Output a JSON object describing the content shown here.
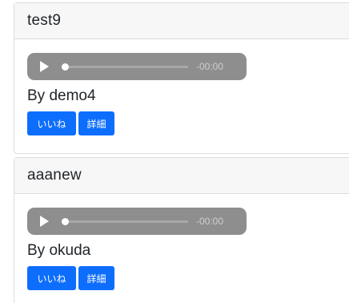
{
  "posts": [
    {
      "title": "test9",
      "audio": {
        "time": "-00:00",
        "progress": 0
      },
      "byline": "By demo4",
      "like_label": "いいね",
      "detail_label": "詳細"
    },
    {
      "title": "aaanew",
      "audio": {
        "time": "-00:00",
        "progress": 0
      },
      "byline": "By okuda",
      "like_label": "いいね",
      "detail_label": "詳細"
    }
  ],
  "colors": {
    "primary": "#0d6efd",
    "audio_bg": "#8e8e8e",
    "header_bg": "#f7f7f7",
    "border": "#dcdcdc"
  },
  "icons": {
    "play": "play-icon"
  }
}
